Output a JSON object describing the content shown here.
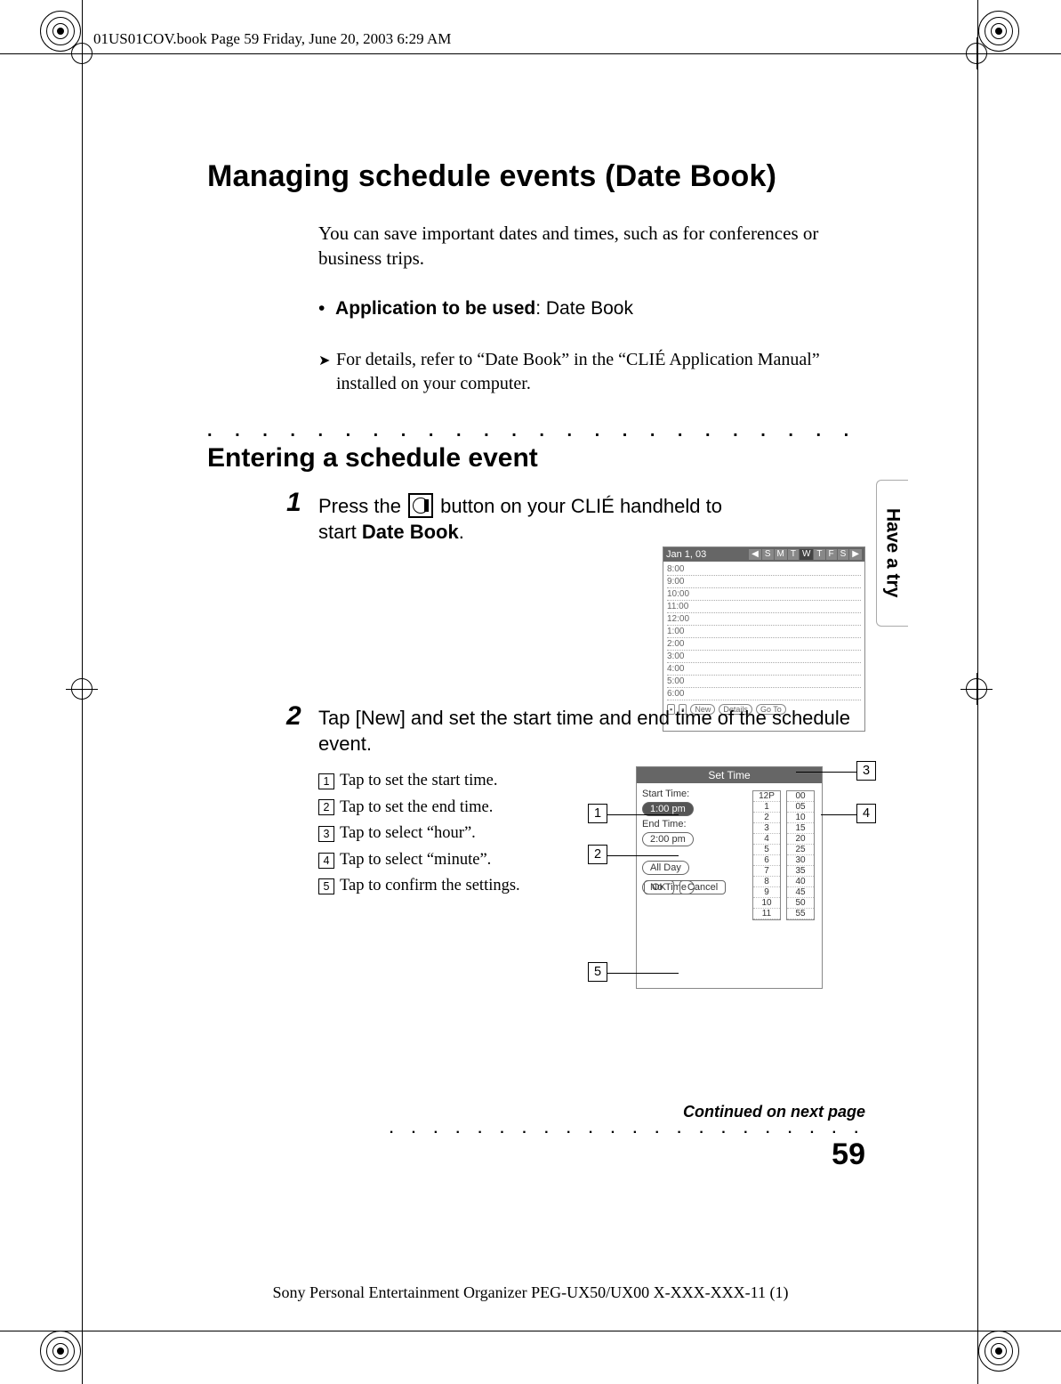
{
  "book_header": "01US01COV.book  Page 59  Friday, June 20, 2003  6:29 AM",
  "title": "Managing schedule events (Date Book)",
  "intro": "You can save important dates and times, such as for conferences or business trips.",
  "app_bullet_label": "Application to be used",
  "app_bullet_value": "Date Book",
  "ref_note": "For details, refer to “Date Book” in the “CLIÉ Application Manual” installed on your computer.",
  "dots": ". . . . . . . . . . . . . . . . . . . . . . . . . . . . . . . . . . . . . . . . . . . . . . . . . . . . . . .",
  "h2": "Entering a schedule event",
  "step1_num": "1",
  "step1_a": "Press the ",
  "step1_b": " button on your CLIÉ handheld to start ",
  "step1_c": "Date Book",
  "step1_d": ".",
  "step2_num": "2",
  "step2_text": "Tap [New] and set the start time and end time of the schedule event.",
  "legend": [
    "Tap to set the start time.",
    "Tap to set the end time.",
    "Tap to select “hour”.",
    "Tap to select “minute”.",
    "Tap to confirm the settings."
  ],
  "legend_nums": [
    "1",
    "2",
    "3",
    "4",
    "5"
  ],
  "day_screen": {
    "date": "Jan 1, 03",
    "days": [
      "S",
      "M",
      "T",
      "W",
      "T",
      "F",
      "S"
    ],
    "times": [
      "8:00",
      "9:00",
      "10:00",
      "11:00",
      "12:00",
      "1:00",
      "2:00",
      "3:00",
      "4:00",
      "5:00",
      "6:00"
    ],
    "footer": [
      "New",
      "Details",
      "Go To"
    ]
  },
  "time_screen": {
    "title": "Set Time",
    "start_label": "Start Time:",
    "end_label": "End Time:",
    "start_val": "1:00 pm",
    "end_val": "2:00 pm",
    "all_day": "All Day",
    "no_time": "No Time",
    "ok": "OK",
    "cancel": "Cancel",
    "hours": [
      "12P",
      "1",
      "2",
      "3",
      "4",
      "5",
      "6",
      "7",
      "8",
      "9",
      "10",
      "11"
    ],
    "mins": [
      "00",
      "05",
      "10",
      "15",
      "20",
      "25",
      "30",
      "35",
      "40",
      "45",
      "50",
      "55"
    ]
  },
  "callouts": {
    "c1": "1",
    "c2": "2",
    "c3": "3",
    "c4": "4",
    "c5": "5"
  },
  "side_tab": "Have a try",
  "continued": "Continued on next page",
  "cont_dots": ". . . . . . . . . . . . . . . . . . . . . .",
  "page_number": "59",
  "footer": "Sony Personal Entertainment Organizer  PEG-UX50/UX00  X-XXX-XXX-11 (1)"
}
